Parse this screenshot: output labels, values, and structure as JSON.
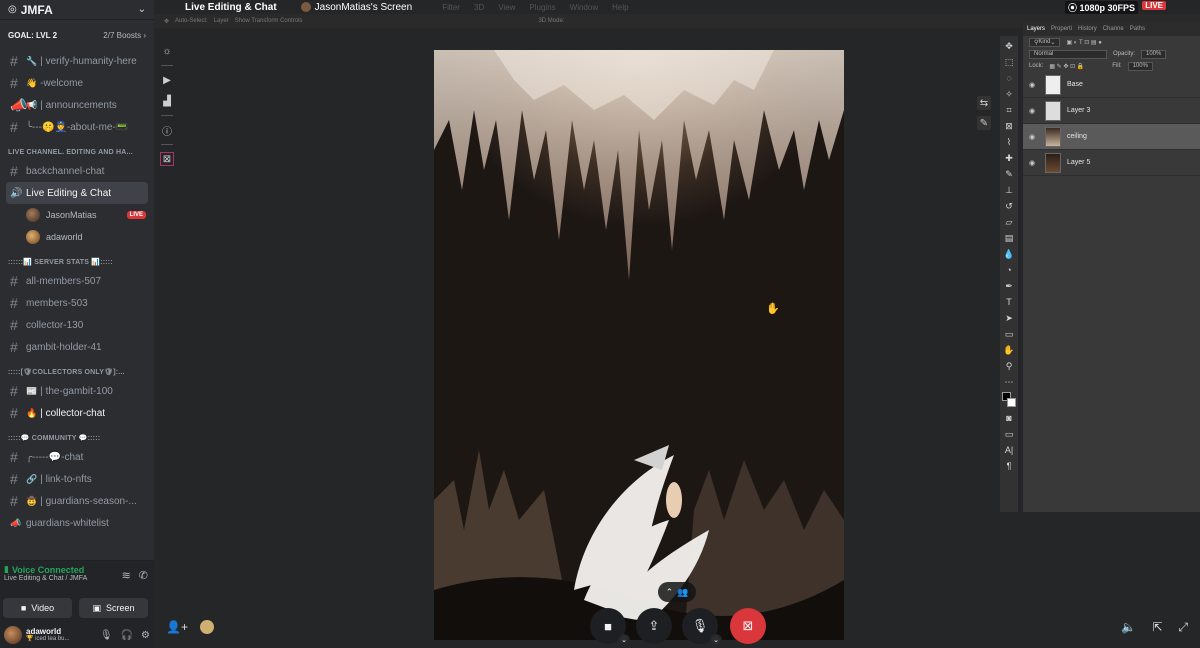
{
  "server": {
    "name": "JMFA",
    "goal": "GOAL: LVL 2",
    "boosts": "2/7 Boosts"
  },
  "channels_top": [
    {
      "emoji": "🔧",
      "label": "| verify-humanity-here"
    },
    {
      "emoji": "👋",
      "label": "-welcome"
    },
    {
      "emoji": "📢",
      "label": "| announcements"
    },
    {
      "emoji": "😊",
      "label": "╰---🤫👮-about-me-📟"
    }
  ],
  "category_live": "LIVE CHANNEL. EDITING AND HA...",
  "channel_backchannel": "backchannel-chat",
  "voice_channel": "Live Editing & Chat",
  "voice_users": [
    {
      "name": "JasonMatias",
      "badge": "LIVE"
    },
    {
      "name": "adaworld"
    }
  ],
  "category_stats": "::::::📊 SERVER STATS 📊:::::",
  "stat_channels": [
    "all-members-507",
    "members-503",
    "collector-130",
    "gambit-holder-41"
  ],
  "category_collectors": ":::::[🛡COLLECTORS ONLY🛡]:...",
  "collector_channels": [
    {
      "emoji": "📰",
      "label": "| the-gambit-100"
    },
    {
      "emoji": "🔥",
      "label": "| collector-chat"
    }
  ],
  "category_community": ":::::💬 COMMUNITY 💬:::::",
  "community_channels": [
    {
      "emoji": "",
      "label": "╭-----💬-chat"
    },
    {
      "emoji": "🔗",
      "label": "| link-to-nfts"
    },
    {
      "emoji": "🤠",
      "label": "| guardians-season-..."
    },
    {
      "emoji": "",
      "label": "guardians-whitelist"
    }
  ],
  "voice_status": {
    "title": "Voice Connected",
    "sub": "Live Editing & Chat / JMFA"
  },
  "voice_buttons": {
    "video": "Video",
    "screen": "Screen"
  },
  "user": {
    "name": "adaworld",
    "status": "🏆 iced tea bu..."
  },
  "stream": {
    "title": "Live Editing & Chat",
    "sharer": "JasonMatias's Screen",
    "quality": "⦿ 1080p 30FPS",
    "live": "LIVE",
    "ps_menus": [
      "Filter",
      "3D",
      "View",
      "Plugins",
      "Window",
      "Help"
    ]
  },
  "photoshop": {
    "options": [
      "Auto-Select:",
      "Layer",
      "Show Transform Controls",
      "3D Mode:"
    ],
    "tabs": [
      "Layers",
      "Properti",
      "History",
      "Channe",
      "Paths"
    ],
    "kind": "Kind",
    "blend": "Normal",
    "opacity_label": "Opacity:",
    "opacity": "100%",
    "lock_label": "Lock:",
    "fill_label": "Fill:",
    "fill": "100%",
    "layers": [
      "Base",
      "Layer 3",
      "ceiling",
      "Layer 5"
    ]
  },
  "colors": {
    "accent_live": "#da373c",
    "voice_green": "#23a559",
    "sidebar": "#2b2d31"
  }
}
